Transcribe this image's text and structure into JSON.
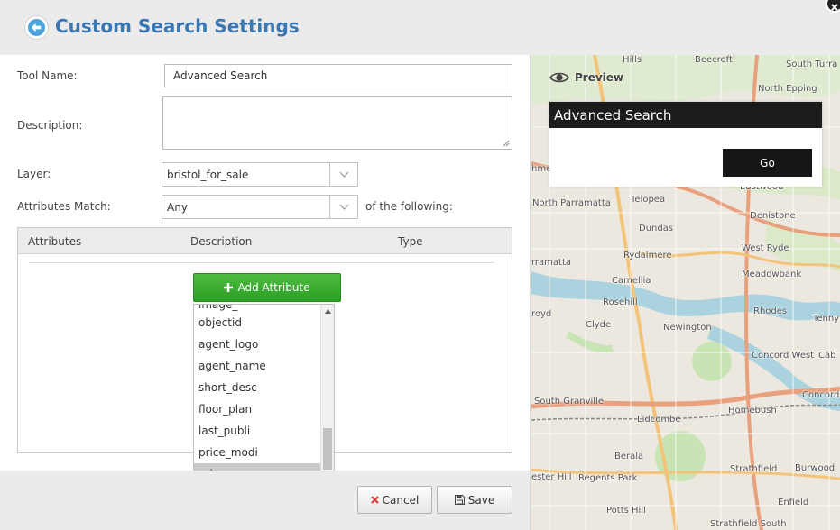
{
  "header": {
    "title": "Custom Search Settings"
  },
  "form": {
    "tool_name_label": "Tool Name:",
    "tool_name_value": "Advanced Search",
    "description_label": "Description:",
    "description_value": "",
    "layer_label": "Layer:",
    "layer_value": "bristol_for_sale",
    "match_label": "Attributes Match:",
    "match_value": "Any",
    "match_suffix": "of the following:"
  },
  "attributes_table": {
    "columns": [
      "Attributes",
      "Description",
      "Type"
    ]
  },
  "add_attribute_button": "Add Attribute",
  "attribute_dropdown": {
    "cut_off_item": "image_",
    "items": [
      "objectid",
      "agent_logo",
      "agent_name",
      "short_desc",
      "floor_plan",
      "last_publi",
      "price_modi",
      "price"
    ],
    "selected": "price"
  },
  "footer": {
    "cancel_label": "Cancel",
    "save_label": "Save"
  },
  "preview": {
    "label": "Preview",
    "widget_title": "Advanced Search",
    "go_label": "Go"
  },
  "map": {
    "places": [
      "Hills",
      "Beecroft",
      "South Turra",
      "North Epping",
      "hme",
      "Eastwood",
      "Telopea",
      "North Parramatta",
      "Denistone",
      "Dundas",
      "West Ryde",
      "rramatta",
      "Rydalmere",
      "Meadowbank",
      "Camellia",
      "Rosehill",
      "Rhodes",
      "Tenny",
      "royd",
      "Clyde",
      "Newington",
      "Concord West",
      "Cab",
      "South Granville",
      "Concord",
      "Lidcombe",
      "Homebush",
      "Berala",
      "Strathfield",
      "Burwood",
      "ester Hill",
      "Regents Park",
      "Enfield",
      "Potts Hill",
      "Strathfield South"
    ]
  },
  "colors": {
    "title_blue": "#3a78b5",
    "add_button_green": "#34a82c",
    "widget_dark": "#1c1c1c"
  },
  "icons": {
    "back": "back-arrow-icon",
    "close": "close-icon",
    "preview": "eye-icon",
    "add": "plus-icon",
    "cancel": "x-icon",
    "save": "floppy-disk-icon"
  }
}
